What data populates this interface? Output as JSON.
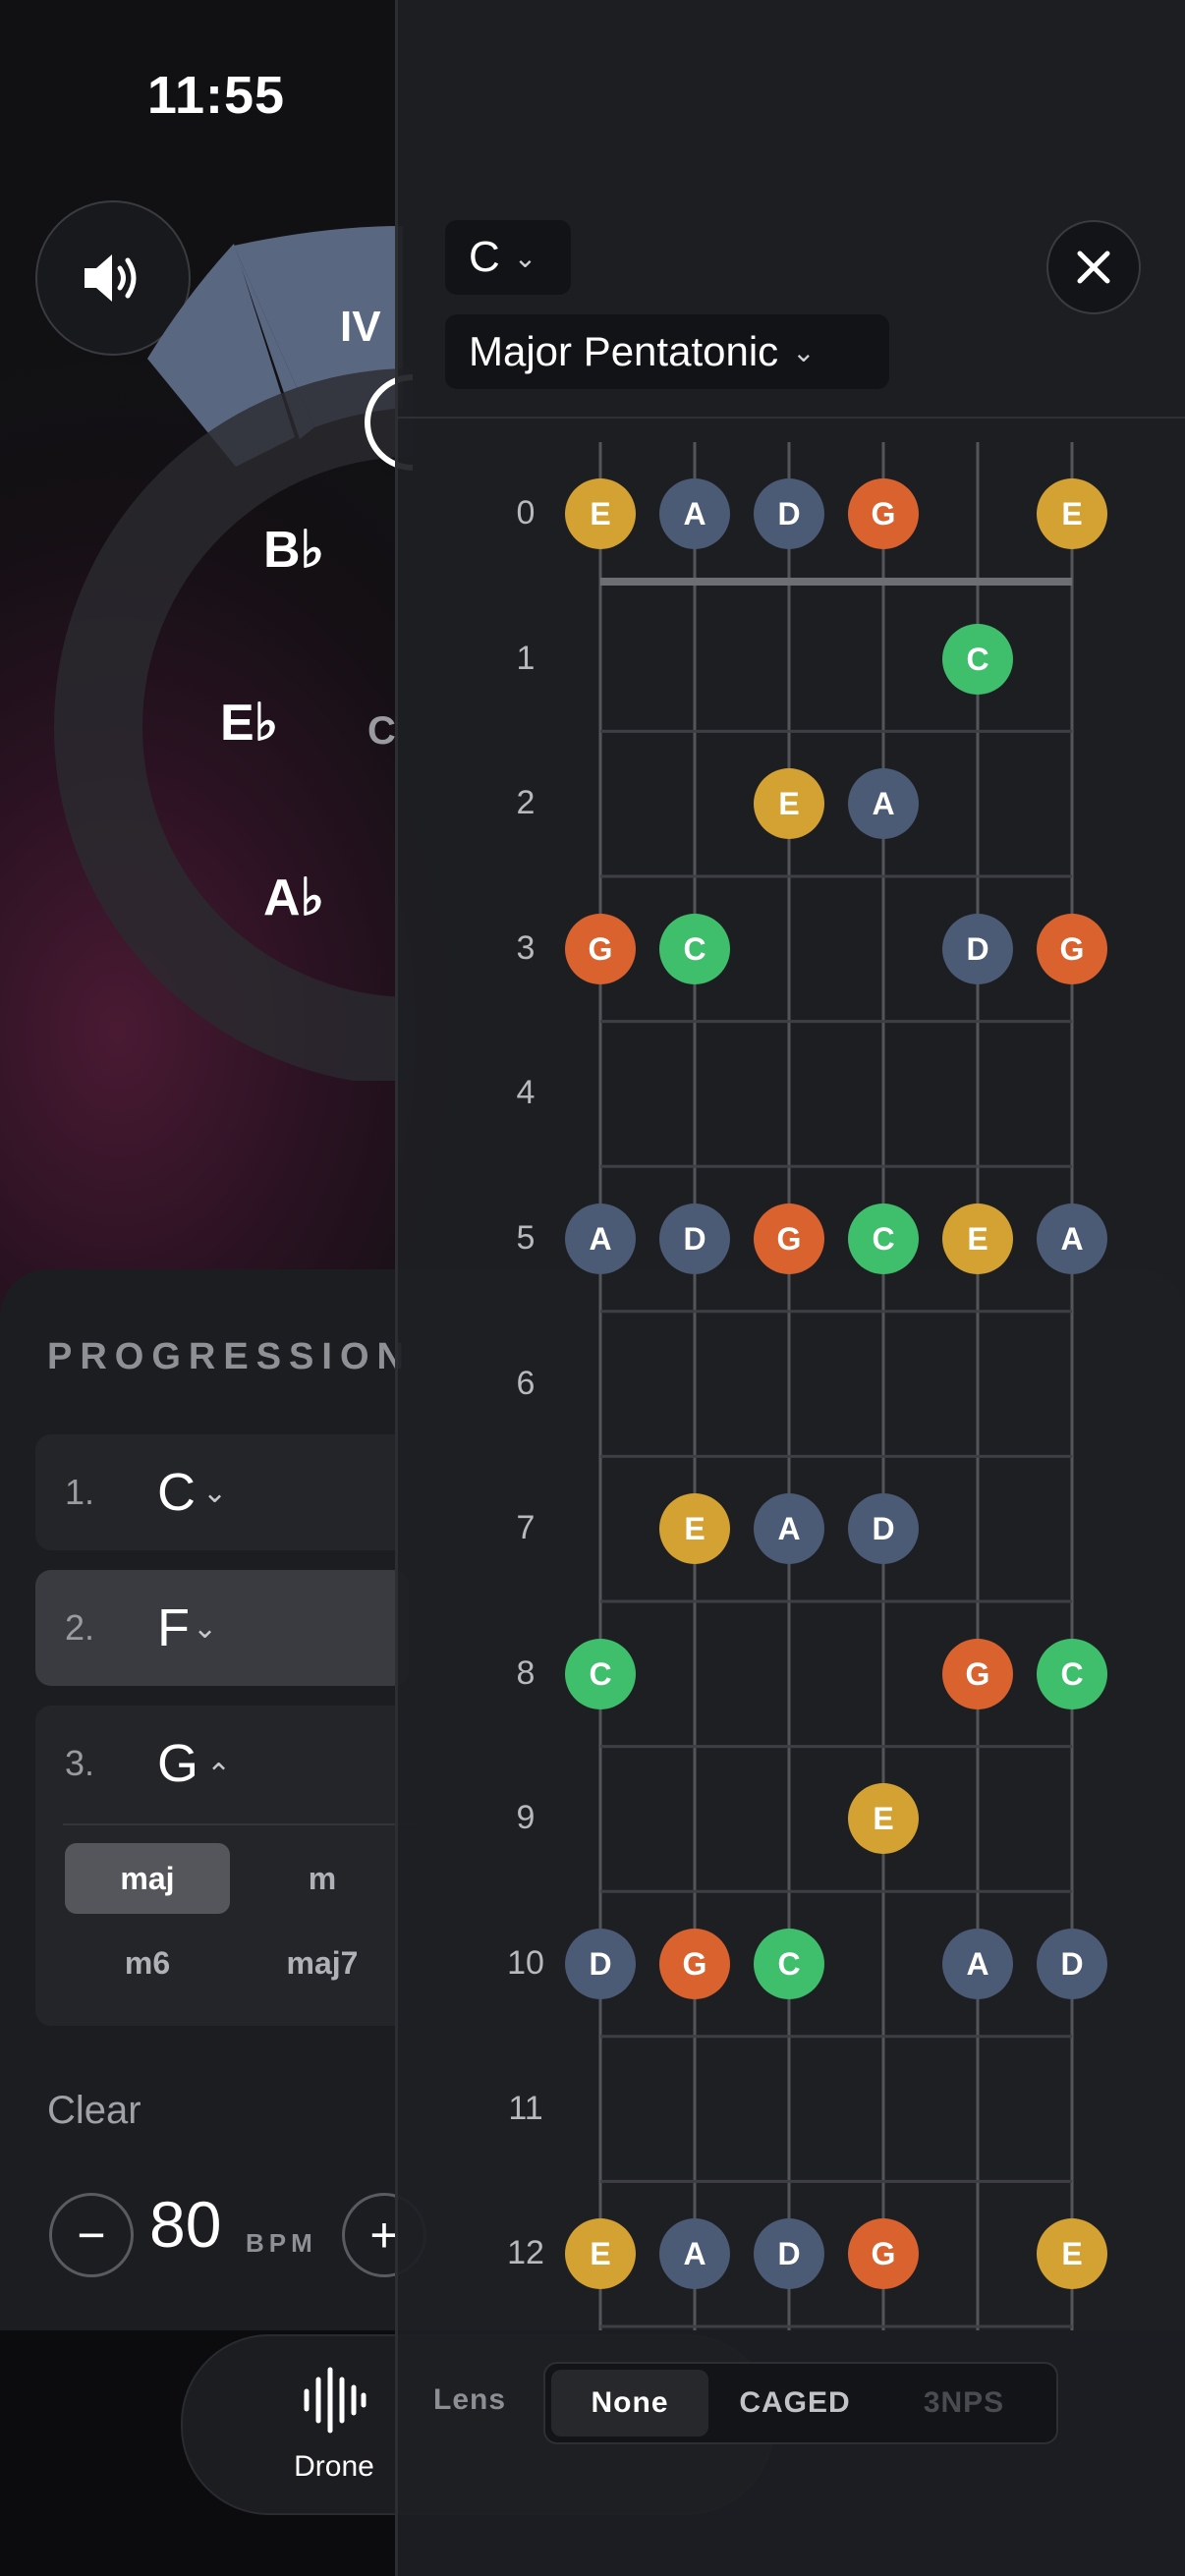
{
  "status": {
    "time": "11:55"
  },
  "wheel": {
    "labels": [
      "IV",
      "B♭",
      "E♭",
      "A♭",
      "C"
    ]
  },
  "progression": {
    "title": "PROGRESSION",
    "rows": [
      {
        "num": "1.",
        "chord": "C",
        "expanded": false
      },
      {
        "num": "2.",
        "chord": "F",
        "expanded": false
      },
      {
        "num": "3.",
        "chord": "G",
        "expanded": true
      }
    ],
    "qualities": [
      "maj",
      "m",
      "m6",
      "maj7"
    ],
    "selected_quality": "maj",
    "clear_label": "Clear",
    "bpm": "80",
    "bpm_unit": "BPM",
    "minus": "−",
    "plus": "+"
  },
  "bottom": {
    "drone_label": "Drone"
  },
  "fretboard_panel": {
    "key": "C",
    "scale": "Major Pentatonic",
    "fret_numbers": [
      "0",
      "1",
      "2",
      "3",
      "4",
      "5",
      "6",
      "7",
      "8",
      "9",
      "10",
      "11",
      "12"
    ],
    "colors": {
      "C": "#3fbf6c",
      "D": "#4b5a75",
      "E": "#d4a232",
      "G": "#d9622f",
      "A": "#4b5a75"
    },
    "notes": [
      {
        "fret": 0,
        "string": 0,
        "note": "E"
      },
      {
        "fret": 0,
        "string": 1,
        "note": "A"
      },
      {
        "fret": 0,
        "string": 2,
        "note": "D"
      },
      {
        "fret": 0,
        "string": 3,
        "note": "G"
      },
      {
        "fret": 0,
        "string": 5,
        "note": "E"
      },
      {
        "fret": 1,
        "string": 4,
        "note": "C"
      },
      {
        "fret": 2,
        "string": 2,
        "note": "E"
      },
      {
        "fret": 2,
        "string": 3,
        "note": "A"
      },
      {
        "fret": 3,
        "string": 0,
        "note": "G"
      },
      {
        "fret": 3,
        "string": 1,
        "note": "C"
      },
      {
        "fret": 3,
        "string": 4,
        "note": "D"
      },
      {
        "fret": 3,
        "string": 5,
        "note": "G"
      },
      {
        "fret": 5,
        "string": 0,
        "note": "A"
      },
      {
        "fret": 5,
        "string": 1,
        "note": "D"
      },
      {
        "fret": 5,
        "string": 2,
        "note": "G"
      },
      {
        "fret": 5,
        "string": 3,
        "note": "C"
      },
      {
        "fret": 5,
        "string": 4,
        "note": "E"
      },
      {
        "fret": 5,
        "string": 5,
        "note": "A"
      },
      {
        "fret": 7,
        "string": 1,
        "note": "E"
      },
      {
        "fret": 7,
        "string": 2,
        "note": "A"
      },
      {
        "fret": 7,
        "string": 3,
        "note": "D"
      },
      {
        "fret": 8,
        "string": 0,
        "note": "C"
      },
      {
        "fret": 8,
        "string": 4,
        "note": "G"
      },
      {
        "fret": 8,
        "string": 5,
        "note": "C"
      },
      {
        "fret": 9,
        "string": 3,
        "note": "E"
      },
      {
        "fret": 10,
        "string": 0,
        "note": "D"
      },
      {
        "fret": 10,
        "string": 1,
        "note": "G"
      },
      {
        "fret": 10,
        "string": 2,
        "note": "C"
      },
      {
        "fret": 10,
        "string": 4,
        "note": "A"
      },
      {
        "fret": 10,
        "string": 5,
        "note": "D"
      },
      {
        "fret": 12,
        "string": 0,
        "note": "E"
      },
      {
        "fret": 12,
        "string": 1,
        "note": "A"
      },
      {
        "fret": 12,
        "string": 2,
        "note": "D"
      },
      {
        "fret": 12,
        "string": 3,
        "note": "G"
      },
      {
        "fret": 12,
        "string": 5,
        "note": "E"
      }
    ],
    "lens": {
      "label": "Lens",
      "options": [
        "None",
        "CAGED",
        "3NPS"
      ],
      "selected": "None"
    }
  }
}
